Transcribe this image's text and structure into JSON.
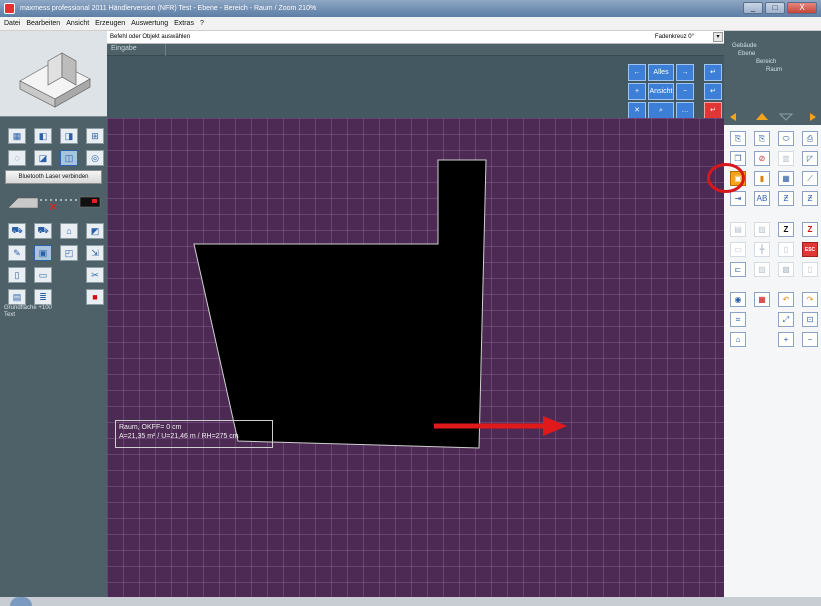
{
  "window": {
    "title": "maxmess professional 2011 Händlerversion (NFR)  Test - Ebene - Bereich - Raum / Zoom 210%",
    "minimize": "_",
    "maximize": "□",
    "close": "X"
  },
  "menu": [
    "Datei",
    "Bearbeiten",
    "Ansicht",
    "Erzeugen",
    "Auswertung",
    "Extras",
    "?"
  ],
  "command": {
    "prompt": "Befehl oder Objekt auswählen",
    "crosshair": "Fadenkreuz 0°",
    "input_label": "Eingabe"
  },
  "keypad": {
    "row1": [
      "←",
      "Alles",
      "→",
      "↵"
    ],
    "row2": [
      "+",
      "Ansicht",
      "−",
      "↵"
    ],
    "row3": [
      "✕",
      "⌕",
      "…",
      "↵"
    ]
  },
  "left_panel": {
    "bluetooth_button": "Bluetooth Laser verbinden",
    "status_lines": [
      "Grundfläche +100",
      "Text"
    ]
  },
  "levels": {
    "building": "Gebäude",
    "level": "Ebene",
    "area": "Bereich",
    "room": "Raum"
  },
  "room_label": {
    "line1": "Raum, OKFF= 0 cm",
    "line2": "A=21,35 m² / U=21,46 m / RH=275 cm"
  },
  "right_tools": {
    "esc": "ESC"
  },
  "colors": {
    "canvas_bg": "#4d2a54",
    "room_fill": "#000000",
    "annotation_red": "#d9161c",
    "accent_blue": "#3d7fd6"
  },
  "icons": {
    "annotation_circle": "red-circle-highlight",
    "annotation_arrow": "red-arrow-right"
  }
}
